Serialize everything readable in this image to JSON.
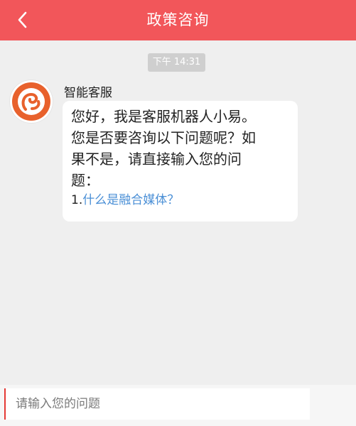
{
  "header": {
    "title": "政策咨询",
    "back_icon": "chevron-left-icon",
    "background": "#f2565a"
  },
  "chat": {
    "timestamp": "下午 14:31",
    "message": {
      "sender": "智能客服",
      "avatar_icon": "service-logo-icon",
      "lines": [
        "您好，我是客服机器人小易。",
        "您是否要咨询以下问题呢？如",
        "果不是，请直接输入您的问",
        "题："
      ],
      "faq": [
        {
          "index": "1.",
          "question": "什么是融合媒体？"
        }
      ]
    }
  },
  "composer": {
    "placeholder": "请输入您的问题",
    "value": ""
  },
  "colors": {
    "accent": "#f2565a",
    "link": "#4a8fd6",
    "background": "#efefef"
  }
}
